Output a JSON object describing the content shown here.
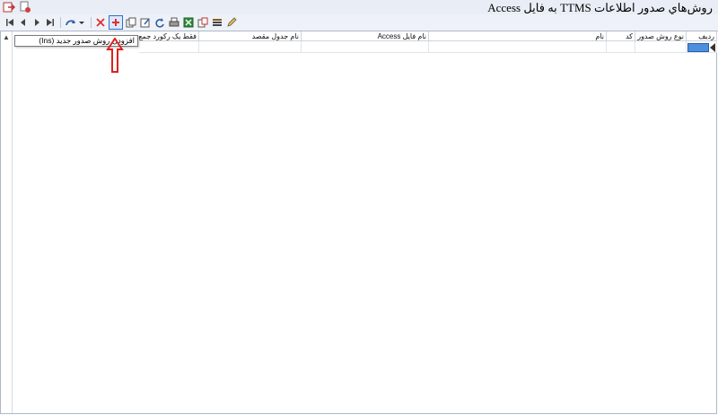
{
  "window": {
    "title": "روش‌هاي صدور اطلاعات TTMS به فايل Access"
  },
  "toolbar": {
    "buttons": [
      "first",
      "previous",
      "next",
      "last",
      "refresh",
      "delete",
      "add",
      "copy",
      "edit",
      "reload",
      "print",
      "excel",
      "export",
      "list",
      "pencil"
    ],
    "add_tooltip": "افزودن روش صدور جديد (Ins)"
  },
  "grid": {
    "columns": [
      "رديف",
      "نوع روش صدور",
      "کد",
      "نام",
      "نام فايل Access",
      "نام جدول مقصد",
      "فقط يک رکورد جمع"
    ]
  },
  "colors": {
    "accent": "#2f6fcf",
    "annotation": "#e02020",
    "row_selected": "#4c8fdc"
  }
}
